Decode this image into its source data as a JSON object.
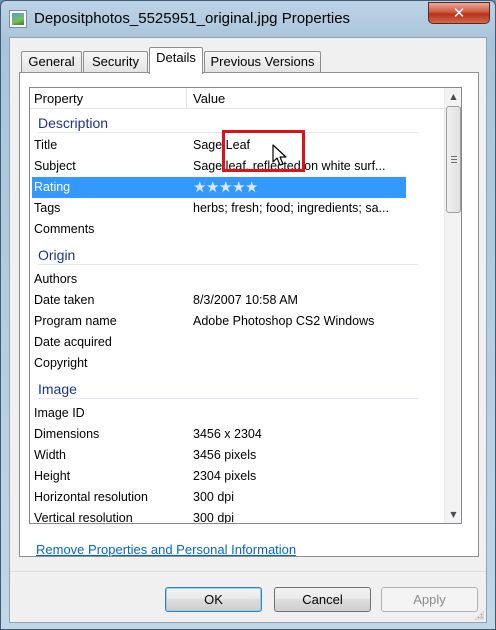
{
  "window": {
    "title": "Depositphotos_5525951_original.jpg Properties",
    "close_glyph": "✕"
  },
  "tabs": [
    {
      "label": "General"
    },
    {
      "label": "Security"
    },
    {
      "label": "Details",
      "active": true
    },
    {
      "label": "Previous Versions"
    }
  ],
  "list": {
    "col_property": "Property",
    "col_value": "Value",
    "groups": {
      "description": "Description",
      "origin": "Origin",
      "image": "Image"
    },
    "rows": {
      "title": {
        "property": "Title",
        "value": "Sage Leaf"
      },
      "subject": {
        "property": "Subject",
        "value": "Sage leaf, reflected on white surf..."
      },
      "rating": {
        "property": "Rating",
        "stars": 5,
        "selected": true
      },
      "tags": {
        "property": "Tags",
        "value": "herbs; fresh; food; ingredients; sa..."
      },
      "comments": {
        "property": "Comments",
        "value": ""
      },
      "authors": {
        "property": "Authors",
        "value": ""
      },
      "date_taken": {
        "property": "Date taken",
        "value": "8/3/2007 10:58 AM"
      },
      "program": {
        "property": "Program name",
        "value": "Adobe Photoshop CS2 Windows"
      },
      "date_acq": {
        "property": "Date acquired",
        "value": ""
      },
      "copyright": {
        "property": "Copyright",
        "value": ""
      },
      "image_id": {
        "property": "Image ID",
        "value": ""
      },
      "dimensions": {
        "property": "Dimensions",
        "value": "3456 x 2304"
      },
      "width": {
        "property": "Width",
        "value": "3456 pixels"
      },
      "height": {
        "property": "Height",
        "value": "2304 pixels"
      },
      "hres": {
        "property": "Horizontal resolution",
        "value": "300 dpi"
      },
      "vres": {
        "property": "Vertical resolution",
        "value": "300 dpi"
      }
    }
  },
  "remove_link": "Remove Properties and Personal Information",
  "buttons": {
    "ok": "OK",
    "cancel": "Cancel",
    "apply": "Apply"
  },
  "icons": {
    "star": "★",
    "scroll_up": "▲",
    "scroll_down": "▼"
  },
  "colors": {
    "selection": "#3399ff",
    "group_title": "#1e3287",
    "link": "#0066cc",
    "annotation": "#e01111"
  }
}
